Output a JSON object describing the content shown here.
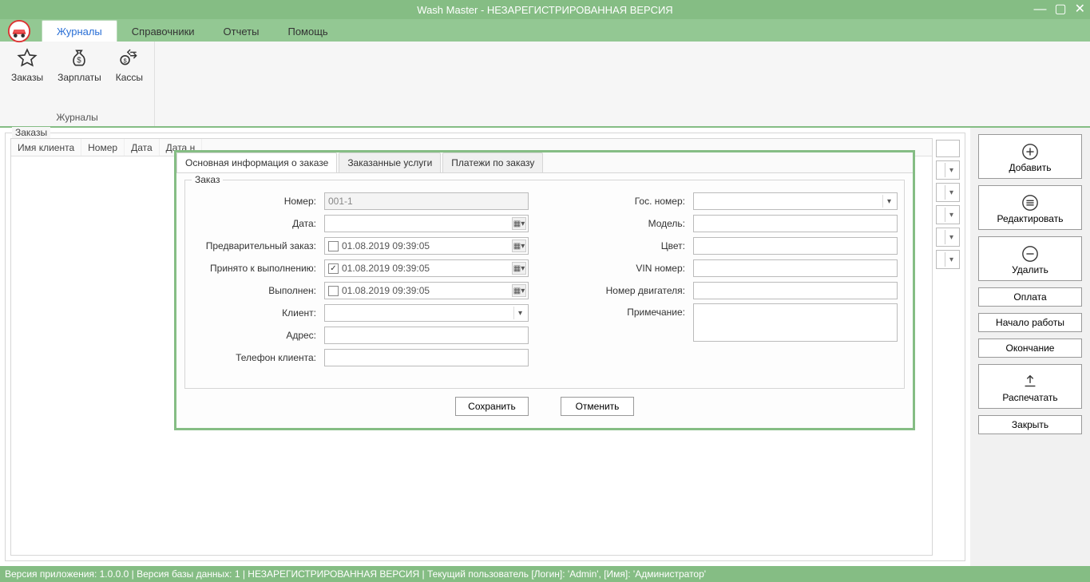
{
  "title": "Wash Master - НЕЗАРЕГИСТРИРОВАННАЯ ВЕРСИЯ",
  "menu": {
    "tabs": [
      "Журналы",
      "Справочники",
      "Отчеты",
      "Помощь"
    ],
    "active": 0
  },
  "ribbon": {
    "group_label": "Журналы",
    "items": [
      {
        "label": "Заказы"
      },
      {
        "label": "Зарплаты"
      },
      {
        "label": "Кассы"
      }
    ]
  },
  "orders": {
    "group_label": "Заказы",
    "columns": [
      "Имя клиента",
      "Номер",
      "Дата",
      "Дата н"
    ]
  },
  "dialog": {
    "tabs": [
      "Основная информация о заказе",
      "Заказанные услуги",
      "Платежи по заказу"
    ],
    "active_tab": 0,
    "fieldset_label": "Заказ",
    "left": {
      "number_label": "Номер:",
      "number_value": "001-1",
      "date_label": "Дата:",
      "date_value": "",
      "pre_label": "Предварительный заказ:",
      "pre_checked": false,
      "pre_date": "01.08.2019 09:39:05",
      "accept_label": "Принято к выполнению:",
      "accept_checked": true,
      "accept_date": "01.08.2019 09:39:05",
      "done_label": "Выполнен:",
      "done_checked": false,
      "done_date": "01.08.2019 09:39:05",
      "client_label": "Клиент:",
      "address_label": "Адрес:",
      "phone_label": "Телефон клиента:"
    },
    "right": {
      "gosnum_label": "Гос. номер:",
      "model_label": "Модель:",
      "color_label": "Цвет:",
      "vin_label": "VIN номер:",
      "engine_label": "Номер двигателя:",
      "note_label": "Примечание:"
    },
    "save_label": "Сохранить",
    "cancel_label": "Отменить"
  },
  "actions": {
    "add": "Добавить",
    "edit": "Редактировать",
    "delete": "Удалить",
    "pay": "Оплата",
    "start": "Начало работы",
    "end": "Окончание",
    "print": "Распечатать",
    "close": "Закрыть"
  },
  "status": "Версия приложения: 1.0.0.0 | Версия базы данных: 1 | НЕЗАРЕГИСТРИРОВАННАЯ ВЕРСИЯ | Текущий пользователь [Логин]: 'Admin', [Имя]: 'Администратор'"
}
